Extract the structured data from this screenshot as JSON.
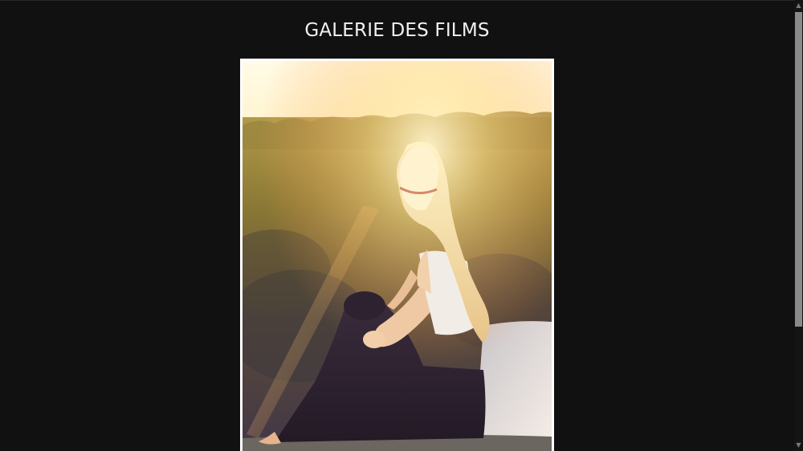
{
  "page": {
    "title": "GALERIE DES FILMS"
  },
  "gallery": {
    "current_image": {
      "subject": "blonde woman sitting on a ledge at sunset, back turned, overlooking forest and water"
    }
  },
  "scrollbar": {
    "up_arrow": "▲",
    "down_arrow": "▼",
    "up_icon": "chevron-up-icon",
    "down_icon": "chevron-down-icon"
  },
  "colors": {
    "background": "#111111",
    "title_text": "#f2f2f2",
    "frame": "#ffffff",
    "scroll_thumb": "#8a8a8a"
  }
}
